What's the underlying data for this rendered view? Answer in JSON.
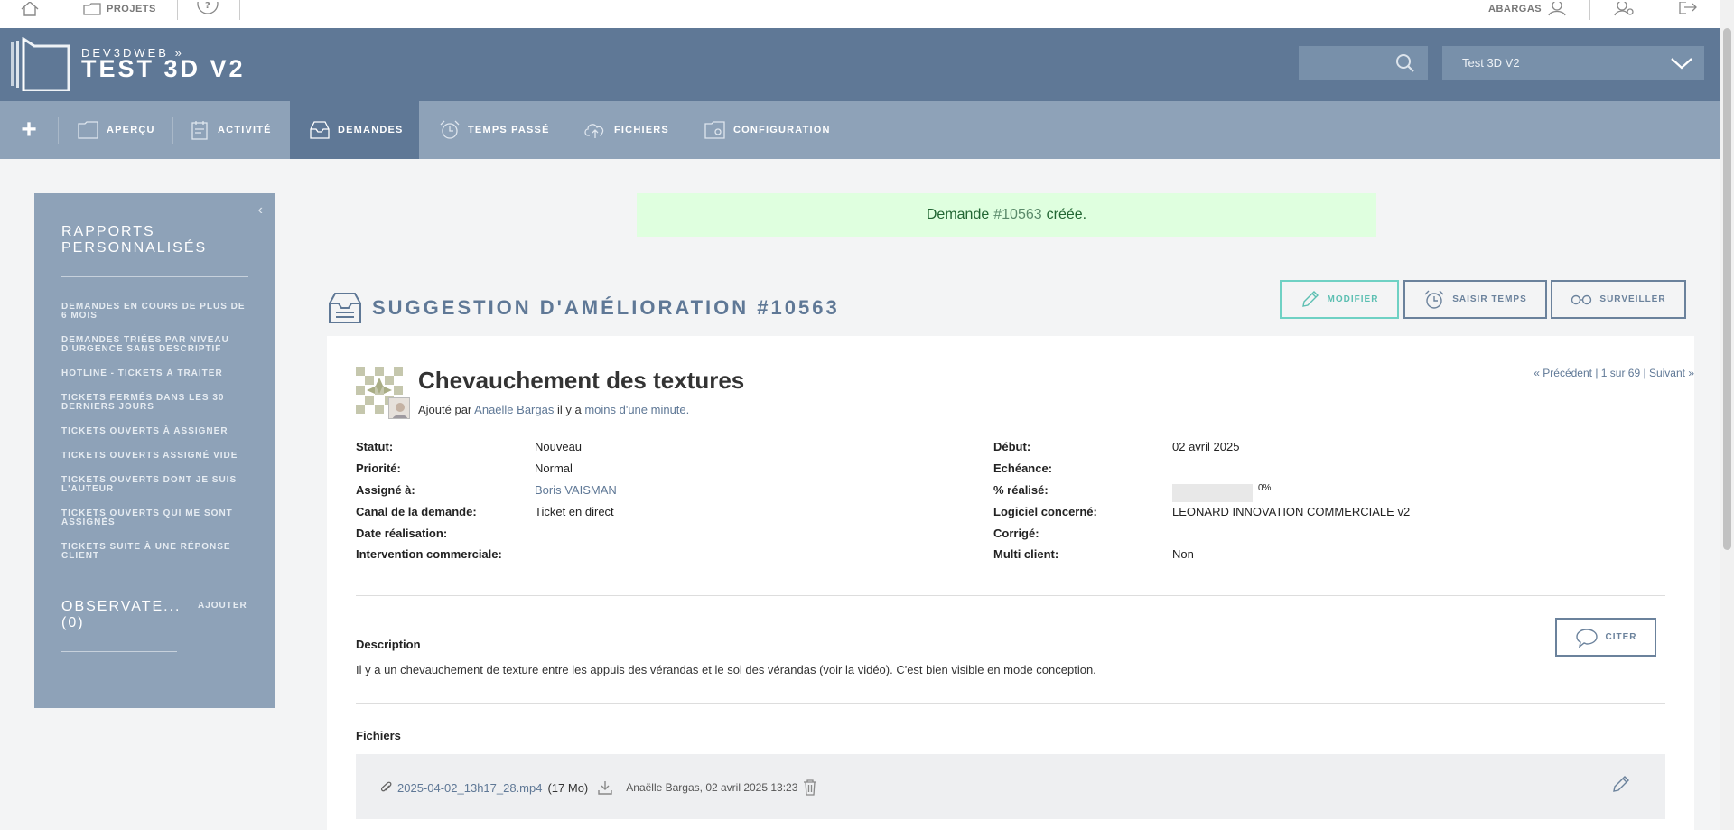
{
  "topbar": {
    "home_icon": "home-icon",
    "projects_label": "PROJETS",
    "help_icon": "help-icon",
    "user_label": "ABARGAS",
    "user_icon": "user-icon",
    "admin_icon": "settings-icon",
    "logout_icon": "logout-icon"
  },
  "header": {
    "brand_small": "DEV3DWEB »",
    "brand_big": "TEST 3D V2",
    "search_placeholder": "",
    "project_select": "Test 3D V2"
  },
  "nav": {
    "items": [
      {
        "label": "APERÇU",
        "icon": "folder-icon"
      },
      {
        "label": "ACTIVITÉ",
        "icon": "activity-icon"
      },
      {
        "label": "DEMANDES",
        "icon": "inbox-icon",
        "active": true
      },
      {
        "label": "TEMPS PASSÉ",
        "icon": "alarm-icon"
      },
      {
        "label": "FICHIERS",
        "icon": "cloud-upload-icon"
      },
      {
        "label": "CONFIGURATION",
        "icon": "folder-settings-icon"
      }
    ]
  },
  "sidebar": {
    "title": "RAPPORTS PERSONNALISÉS",
    "links": [
      "DEMANDES EN COURS DE PLUS DE 6 MOIS",
      "DEMANDES TRIÉES PAR NIVEAU D'URGENCE SANS DESCRIPTIF",
      "HOTLINE - TICKETS À TRAITER",
      "TICKETS FERMÉS DANS LES 30 DERNIERS JOURS",
      "TICKETS OUVERTS À ASSIGNER",
      "TICKETS OUVERTS ASSIGNÉ VIDE",
      "TICKETS OUVERTS DONT JE SUIS L'AUTEUR",
      "TICKETS OUVERTS QUI ME SONT ASSIGNÉS",
      "TICKETS SUITE À UNE RÉPONSE CLIENT"
    ],
    "observers_title": "OBSERVATE... (0)",
    "observers_add": "AJOUTER"
  },
  "flash": {
    "prefix": "Demande",
    "number": "#10563",
    "suffix": "créée."
  },
  "issue": {
    "heading": "SUGGESTION D'AMÉLIORATION #10563",
    "actions": {
      "edit": "MODIFIER",
      "log_time": "SAISIR TEMPS",
      "watch": "SURVEILLER"
    },
    "subject": "Chevauchement des textures",
    "added_by_prefix": "Ajouté par",
    "author": "Anaëlle Bargas",
    "ago_prefix": "il y a",
    "ago": "moins d'une minute.",
    "prev": "« Précédent",
    "position": "1 sur 69",
    "next": "Suivant »",
    "left_attrs": [
      {
        "label": "Statut:",
        "value": "Nouveau"
      },
      {
        "label": "Priorité:",
        "value": "Normal"
      },
      {
        "label": "Assigné à:",
        "value": "Boris VAISMAN"
      },
      {
        "label": "Canal de la demande:",
        "value": "Ticket en direct"
      },
      {
        "label": "Date réalisation:",
        "value": ""
      },
      {
        "label": "Intervention commerciale:",
        "value": ""
      }
    ],
    "right_attrs": [
      {
        "label": "Début:",
        "value": "02 avril 2025"
      },
      {
        "label": "Echéance:",
        "value": ""
      },
      {
        "label": "% réalisé:",
        "value": "0%"
      },
      {
        "label": "Logiciel concerné:",
        "value": "LEONARD INNOVATION COMMERCIALE v2"
      },
      {
        "label": "Corrigé:",
        "value": ""
      },
      {
        "label": "Multi client:",
        "value": "Non"
      }
    ],
    "progress_done": 0,
    "description_title": "Description",
    "cite": "CITER",
    "description": "Il y a un chevauchement de texture entre les appuis des vérandas et le sol des vérandas (voir la vidéo). C'est bien visible en mode conception.",
    "files_title": "Fichiers",
    "file": {
      "name": "2025-04-02_13h17_28.mp4",
      "size": "(17 Mo)",
      "meta": "Anaëlle Bargas, 02 avril 2025 13:23"
    }
  },
  "colors": {
    "header_bg": "#5f7896",
    "nav_bg": "#8ea2b8",
    "flash_bg": "#dfffdf",
    "accent_teal": "#5cbfb2"
  }
}
